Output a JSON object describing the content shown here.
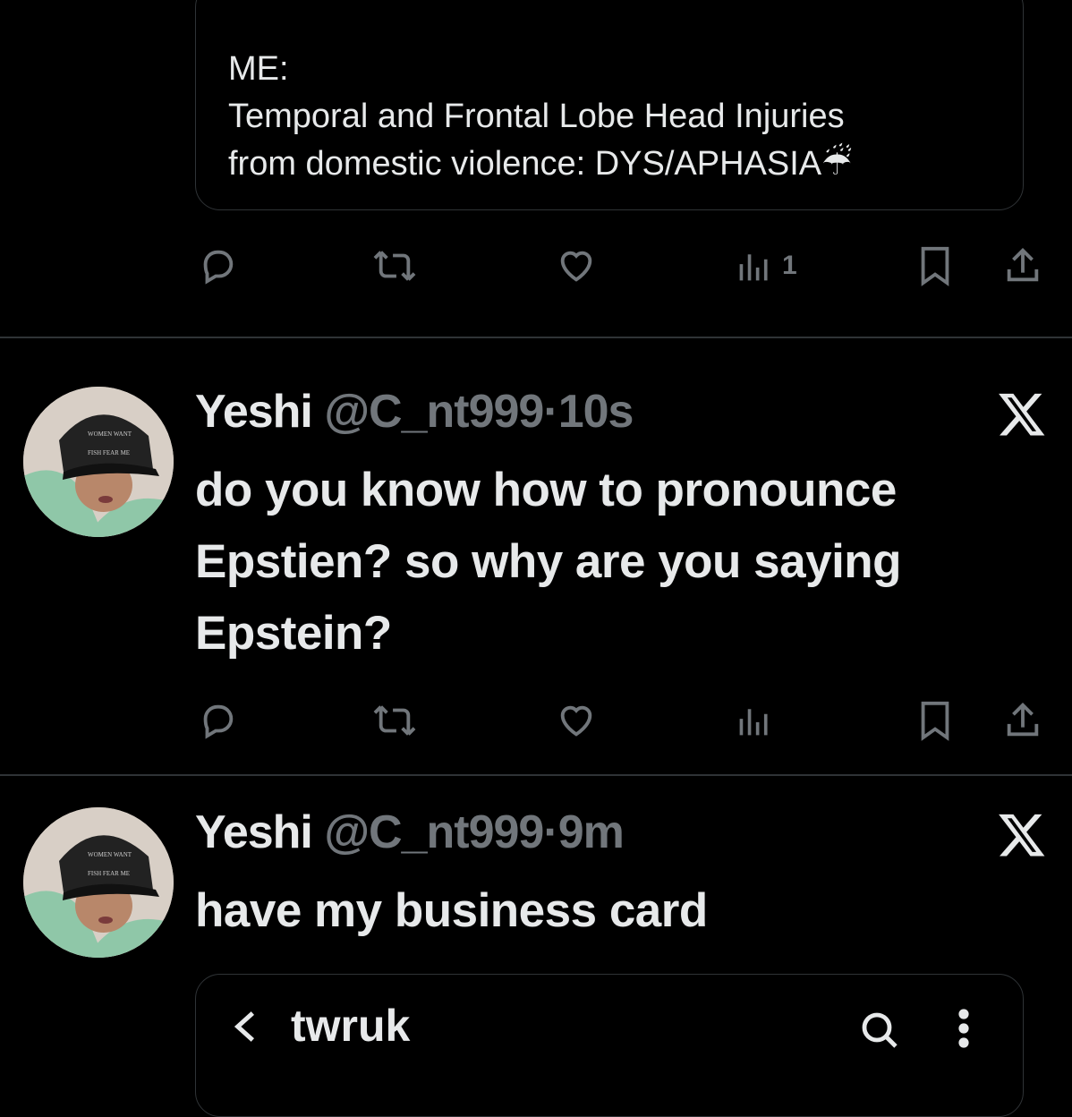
{
  "quote": {
    "lines": [
      "ME:",
      "Temporal and Frontal Lobe Head Injuries",
      "from domestic violence: DYS/APHASIA☔"
    ]
  },
  "actions_1": {
    "views": "1"
  },
  "tweet1": {
    "name": "Yeshi",
    "handle": "@C_nt999",
    "separator": "·",
    "time": "10s",
    "x_label": "X",
    "lines": [
      "do you know how to pronounce",
      "Epstien? so why are you saying",
      "Epstein?"
    ]
  },
  "tweet2": {
    "name": "Yeshi",
    "handle": "@C_nt999",
    "separator": "·",
    "time": "9m",
    "x_label": "X",
    "lines": [
      "have my business card"
    ]
  },
  "embed": {
    "back": "<",
    "title": "twruk"
  },
  "icons": [
    "reply-icon",
    "retweet-icon",
    "like-icon",
    "views-icon",
    "bookmark-icon",
    "share-icon",
    "x-logo-icon",
    "search-icon",
    "more-icon"
  ],
  "colors": {
    "background": "#000000",
    "text": "#e7e9ea",
    "muted": "#71767b",
    "border": "#2f3336",
    "umbrella": "#9b30ff"
  }
}
